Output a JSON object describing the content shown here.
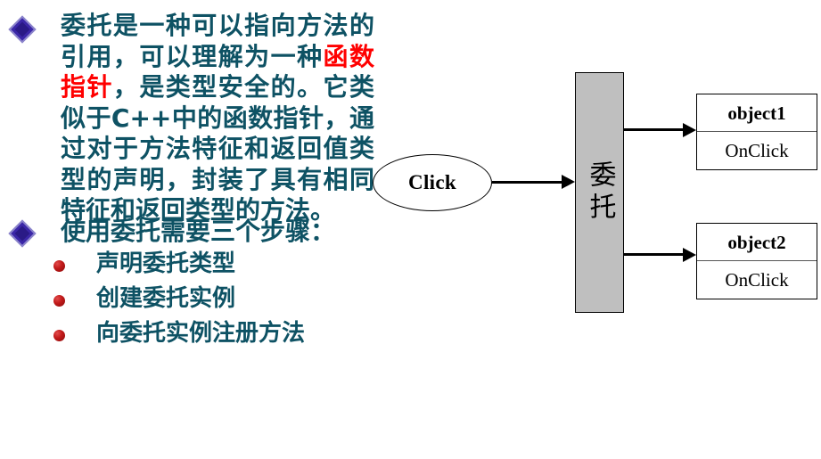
{
  "slide": {
    "bullets": [
      {
        "icon": "diamond-bullet",
        "text_parts": [
          {
            "text": "委托是一种可以指向方法的引用，可以理解为一种",
            "highlight": false
          },
          {
            "text": "函数指针",
            "highlight": true
          },
          {
            "text": "，是类型安全的。它类似于C++中的函数指针，通过对于方法特征和返回值类型的声明，封装了具有相同特征和返回类型的方法。",
            "highlight": false
          }
        ],
        "plain_text": "委托是一种可以指向方法的引用，可以理解为一种函数指针，是类型安全的。它类似于C++中的函数指针，通过对于方法特征和返回值类型的声明，封装了具有相同特征和返回类型的方法。"
      },
      {
        "icon": "diamond-bullet",
        "plain_text": "使用委托需要三个步骤："
      }
    ],
    "sub_bullets": [
      {
        "icon": "red-ball-bullet",
        "label": "声明委托类型"
      },
      {
        "icon": "red-ball-bullet",
        "label": "创建委托实例"
      },
      {
        "icon": "red-ball-bullet",
        "label": "向委托实例注册方法"
      }
    ]
  },
  "diagram": {
    "event_node": {
      "label": "Click",
      "shape": "ellipse"
    },
    "delegate_node": {
      "label": "委托",
      "shape": "vertical-bar",
      "fill": "#bfbfbf"
    },
    "targets": [
      {
        "title": "object1",
        "method": "OnClick"
      },
      {
        "title": "object2",
        "method": "OnClick"
      }
    ],
    "arrows": [
      {
        "from": "event_node",
        "to": "delegate_node"
      },
      {
        "from": "delegate_node",
        "to": "object1"
      },
      {
        "from": "delegate_node",
        "to": "object2"
      }
    ]
  },
  "colors": {
    "body_text": "#0e5264",
    "highlight_text": "#ff0000",
    "diamond_bullet": "#3b27a8",
    "red_bullet": "#c21a1a",
    "delegate_fill": "#bfbfbf",
    "outline": "#000000",
    "background": "#ffffff"
  }
}
